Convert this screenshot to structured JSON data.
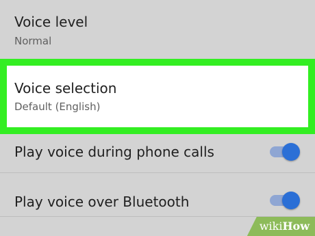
{
  "settings": {
    "voice_level": {
      "title": "Voice level",
      "value": "Normal"
    },
    "voice_selection": {
      "title": "Voice selection",
      "value": "Default (English)",
      "highlight_color": "#33ee22"
    },
    "phone_calls": {
      "title": "Play voice during phone calls",
      "enabled": true
    },
    "bluetooth": {
      "title": "Play voice over Bluetooth",
      "enabled": true
    }
  },
  "colors": {
    "background": "#d3d3d3",
    "toggle_thumb": "#2b6fd6",
    "toggle_track": "#8fa6d3"
  },
  "watermark": {
    "wiki": "wiki",
    "how": "How"
  }
}
